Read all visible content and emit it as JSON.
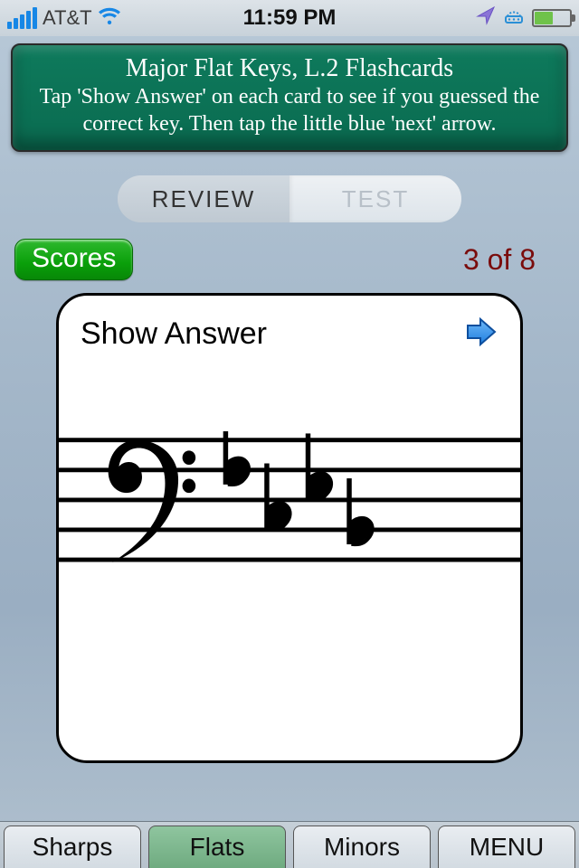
{
  "statusBar": {
    "carrier": "AT&T",
    "time": "11:59 PM"
  },
  "chalkboard": {
    "title": "Major Flat Keys, L.2 Flashcards",
    "body": "Tap 'Show Answer' on each card to see if you guessed the correct key. Then tap the little blue 'next' arrow."
  },
  "mode": {
    "review": "REVIEW",
    "test": "TEST"
  },
  "scoresLabel": "Scores",
  "counter": "3 of 8",
  "card": {
    "showAnswer": "Show Answer"
  },
  "tabs": {
    "sharps": "Sharps",
    "flats": "Flats",
    "minors": "Minors",
    "menu": "MENU"
  }
}
